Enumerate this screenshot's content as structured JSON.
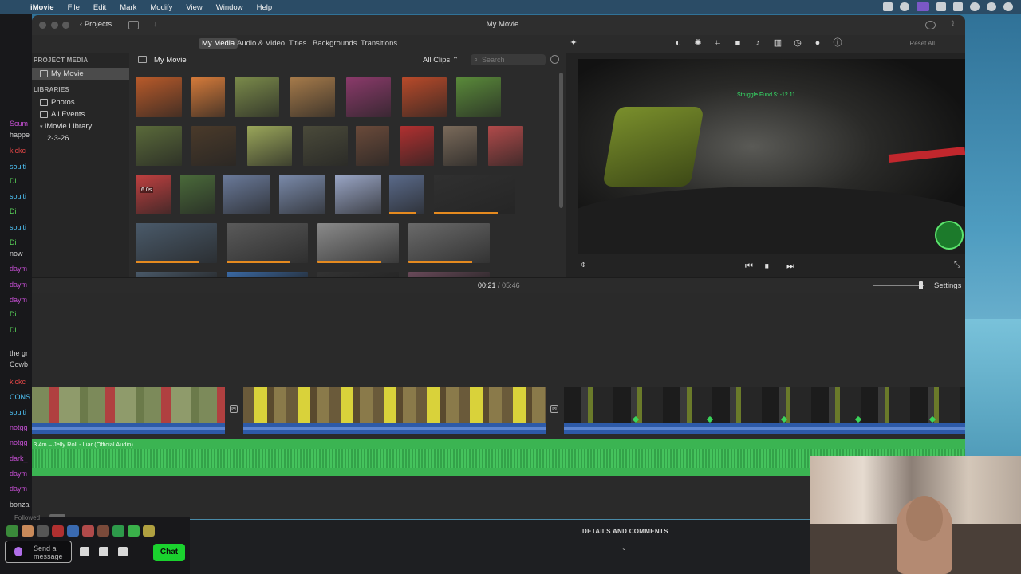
{
  "menubar": {
    "items": [
      "iMovie",
      "File",
      "Edit",
      "Mark",
      "Modify",
      "View",
      "Window",
      "Help"
    ]
  },
  "window": {
    "title": "My Movie",
    "projects_label": "Projects"
  },
  "tabs": [
    "My Media",
    "Audio & Video",
    "Titles",
    "Backgrounds",
    "Transitions"
  ],
  "reset_all": "Reset All",
  "sidebar": {
    "project_media_heading": "PROJECT MEDIA",
    "project_item": "My Movie",
    "libraries_heading": "LIBRARIES",
    "items": [
      "Photos",
      "All Events",
      "iMovie Library",
      "2-3-26"
    ]
  },
  "media": {
    "title": "My Movie",
    "filter": "All Clips",
    "search_placeholder": "Search",
    "thumb_duration_badge": "6.0s"
  },
  "viewer": {
    "overlay_text": "Struggle Fund $: -12.11"
  },
  "timecode": {
    "current": "00:21",
    "separator": "/",
    "duration": "05:46"
  },
  "settings_label": "Settings",
  "timeline": {
    "audio_label": "3.4m – Jelly Roll - Liar (Official Audio)"
  },
  "details": {
    "label": "DETAILS AND COMMENTS"
  },
  "chat": {
    "lines": [
      "Scum",
      "happe",
      "kickc",
      "soulti",
      "Di",
      "soulti",
      "Di",
      "soulti",
      "Di",
      "now",
      "daym",
      "daym",
      "daym",
      "Di",
      "Di",
      "the gr",
      "Cowb",
      "kickc",
      "CONS",
      "soulti",
      "notgg",
      "notgg",
      "dark_",
      "daym",
      "daym",
      "bonza"
    ],
    "followed": "Followed",
    "send_placeholder": "Send a message",
    "chat_button": "Chat"
  }
}
